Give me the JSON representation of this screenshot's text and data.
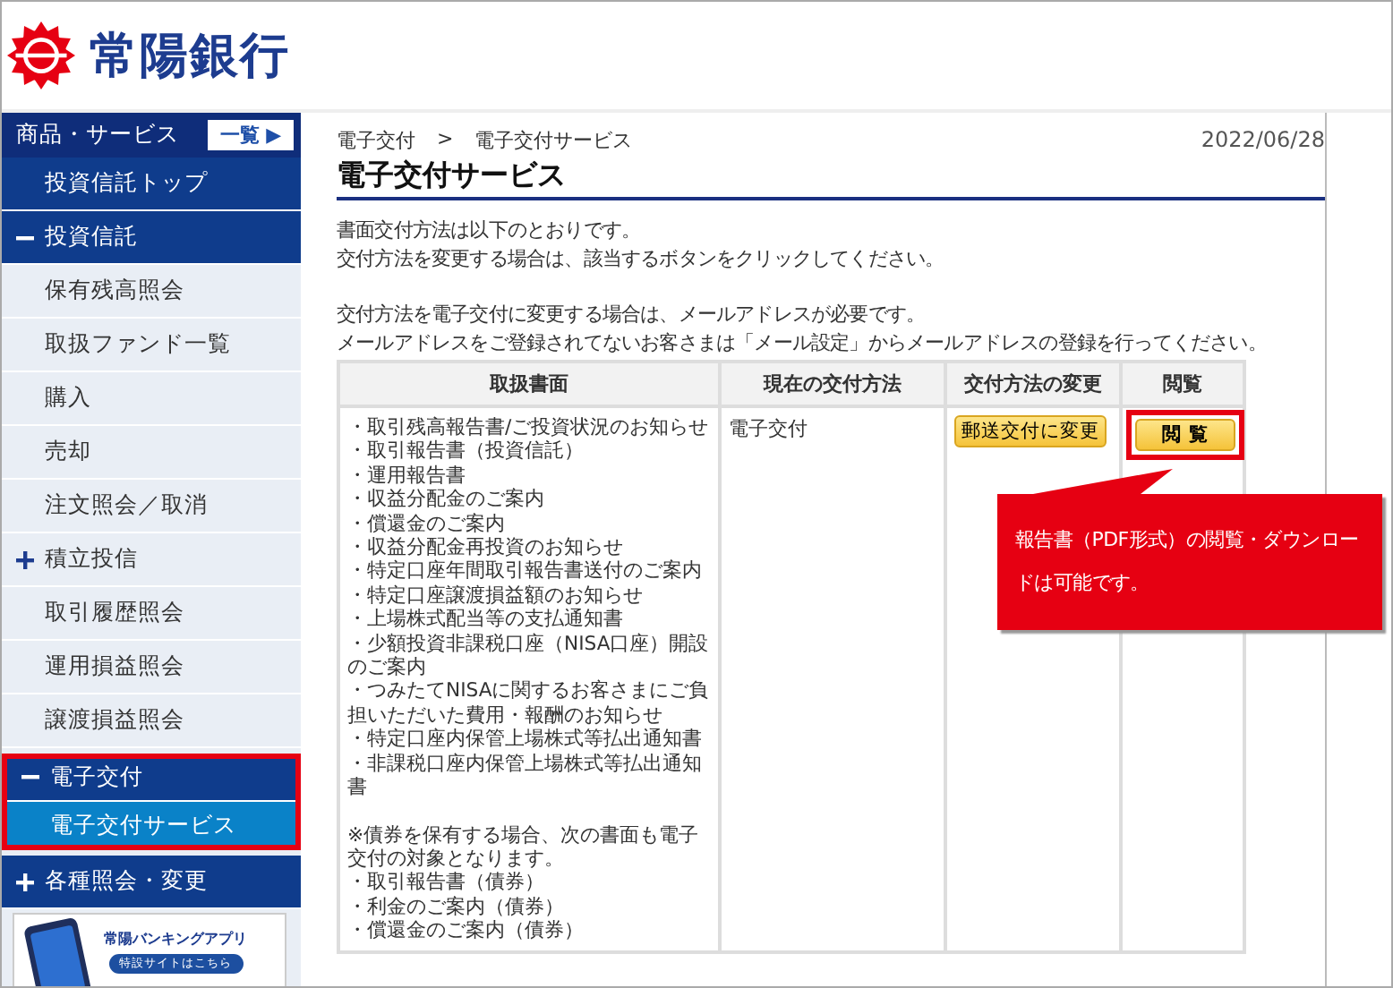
{
  "logo": {
    "text": "常陽銀行"
  },
  "sidebar": {
    "header": {
      "label": "商品・サービス",
      "button": "一覧 ▶"
    },
    "items": [
      {
        "kind": "top",
        "label": "投資信託トップ",
        "selected": false,
        "highlighted": false
      },
      {
        "kind": "section",
        "label": "投資信託",
        "expanded": true,
        "selected": false,
        "highlighted": false
      },
      {
        "kind": "item",
        "label": "保有残高照会",
        "selected": false,
        "highlighted": false
      },
      {
        "kind": "item",
        "label": "取扱ファンド一覧",
        "selected": false,
        "highlighted": false
      },
      {
        "kind": "item",
        "label": "購入",
        "selected": false,
        "highlighted": false
      },
      {
        "kind": "item",
        "label": "売却",
        "selected": false,
        "highlighted": false
      },
      {
        "kind": "item",
        "label": "注文照会／取消",
        "selected": false,
        "highlighted": false
      },
      {
        "kind": "subsection",
        "label": "積立投信",
        "expanded": false,
        "selected": false,
        "highlighted": false
      },
      {
        "kind": "item",
        "label": "取引履歴照会",
        "selected": false,
        "highlighted": false
      },
      {
        "kind": "item",
        "label": "運用損益照会",
        "selected": false,
        "highlighted": false
      },
      {
        "kind": "item",
        "label": "譲渡損益照会",
        "selected": false,
        "highlighted": false
      },
      {
        "kind": "section",
        "label": "電子交付",
        "expanded": true,
        "selected": false,
        "highlighted": true
      },
      {
        "kind": "top",
        "label": "電子交付サービス",
        "selected": true,
        "highlighted": true
      },
      {
        "kind": "section",
        "label": "各種照会・変更",
        "expanded": false,
        "selected": false,
        "highlighted": false
      }
    ],
    "banner": {
      "title": "常陽バンキングアプリ",
      "button": "特設サイトはこちら"
    }
  },
  "breadcrumb": [
    "電子交付",
    "電子交付サービス"
  ],
  "breadcrumb_separator": ">",
  "date": "2022/06/28",
  "title": "電子交付サービス",
  "intro": [
    "書面交付方法は以下のとおりです。",
    "交付方法を変更する場合は、該当するボタンをクリックしてください。"
  ],
  "notice": [
    "交付方法を電子交付に変更する場合は、メールアドレスが必要です。",
    "メールアドレスをご登録されてないお客さまは「メール設定」からメールアドレスの登録を行ってください。"
  ],
  "table": {
    "columns": [
      "取扱書面",
      "現在の交付方法",
      "交付方法の変更",
      "閲覧"
    ],
    "rows": [
      {
        "documents": [
          "・取引残高報告書/ご投資状況のお知らせ",
          "・取引報告書（投資信託）",
          "・運用報告書",
          "・収益分配金のご案内",
          "・償還金のご案内",
          "・収益分配金再投資のお知らせ",
          "・特定口座年間取引報告書送付のご案内",
          "・特定口座譲渡損益額のお知らせ",
          "・上場株式配当等の支払通知書",
          "・少額投資非課税口座（NISA口座）開設のご案内",
          "・つみたてNISAに関するお客さまにご負担いただいた費用・報酬のお知らせ",
          "・特定口座内保管上場株式等払出通知書",
          "・非課税口座内保管上場株式等払出通知書"
        ],
        "bond_note": "※債券を保有する場合、次の書面も電子交付の対象となります。",
        "bond_documents": [
          "・取引報告書（債券）",
          "・利金のご案内（債券）",
          "・償還金のご案内（債券）"
        ],
        "method": "電子交付",
        "change_button": "郵送交付に変更",
        "view_button": "閲 覧",
        "view_highlighted": true
      }
    ]
  },
  "callout": {
    "text": "報告書（PDF形式）の閲覧・ダウンロードは可能です。"
  }
}
